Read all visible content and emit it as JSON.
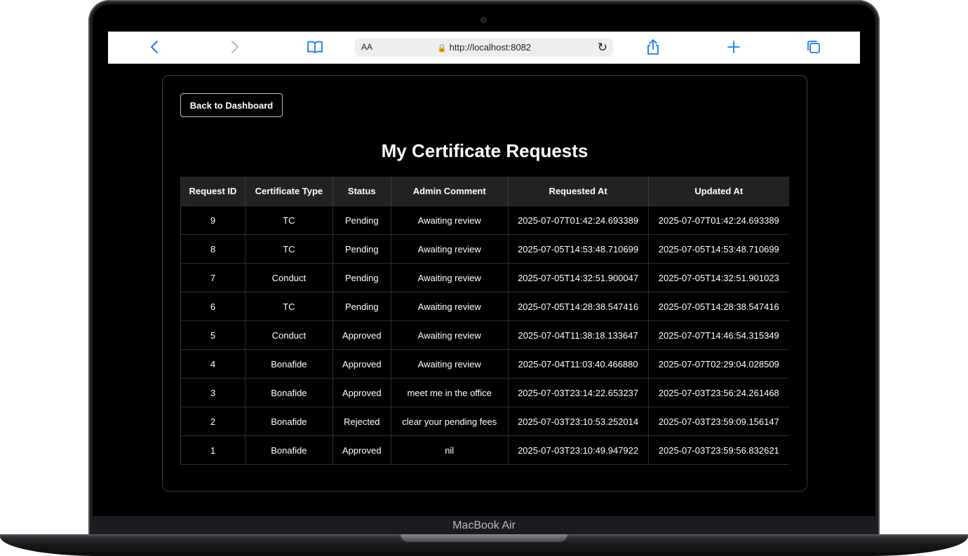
{
  "device": {
    "label": "MacBook Air"
  },
  "browser": {
    "text_size_label": "AA",
    "url": "http://localhost:8082"
  },
  "page": {
    "back_button_label": "Back to Dashboard",
    "title": "My Certificate Requests"
  },
  "table": {
    "headers": [
      "Request ID",
      "Certificate Type",
      "Status",
      "Admin Comment",
      "Requested At",
      "Updated At"
    ],
    "rows": [
      [
        "9",
        "TC",
        "Pending",
        "Awaiting review",
        "2025-07-07T01:42:24.693389",
        "2025-07-07T01:42:24.693389"
      ],
      [
        "8",
        "TC",
        "Pending",
        "Awaiting review",
        "2025-07-05T14:53:48.710699",
        "2025-07-05T14:53:48.710699"
      ],
      [
        "7",
        "Conduct",
        "Pending",
        "Awaiting review",
        "2025-07-05T14:32:51.900047",
        "2025-07-05T14:32:51.901023"
      ],
      [
        "6",
        "TC",
        "Pending",
        "Awaiting review",
        "2025-07-05T14:28:38.547416",
        "2025-07-05T14:28:38.547416"
      ],
      [
        "5",
        "Conduct",
        "Approved",
        "Awaiting review",
        "2025-07-04T11:38:18.133647",
        "2025-07-07T14:46:54.315349"
      ],
      [
        "4",
        "Bonafide",
        "Approved",
        "Awaiting review",
        "2025-07-04T11:03:40.466880",
        "2025-07-07T02:29:04.028509"
      ],
      [
        "3",
        "Bonafide",
        "Approved",
        "meet me in the office",
        "2025-07-03T23:14:22.653237",
        "2025-07-03T23:56:24.261468"
      ],
      [
        "2",
        "Bonafide",
        "Rejected",
        "clear your pending fees",
        "2025-07-03T23:10:53.252014",
        "2025-07-03T23:59:09.156147"
      ],
      [
        "1",
        "Bonafide",
        "Approved",
        "nil",
        "2025-07-03T23:10:49.947922",
        "2025-07-03T23:59:56.832621"
      ]
    ]
  },
  "colors": {
    "accent": "#1a7cf5",
    "page_background": "#000000",
    "header_background": "#222222"
  }
}
